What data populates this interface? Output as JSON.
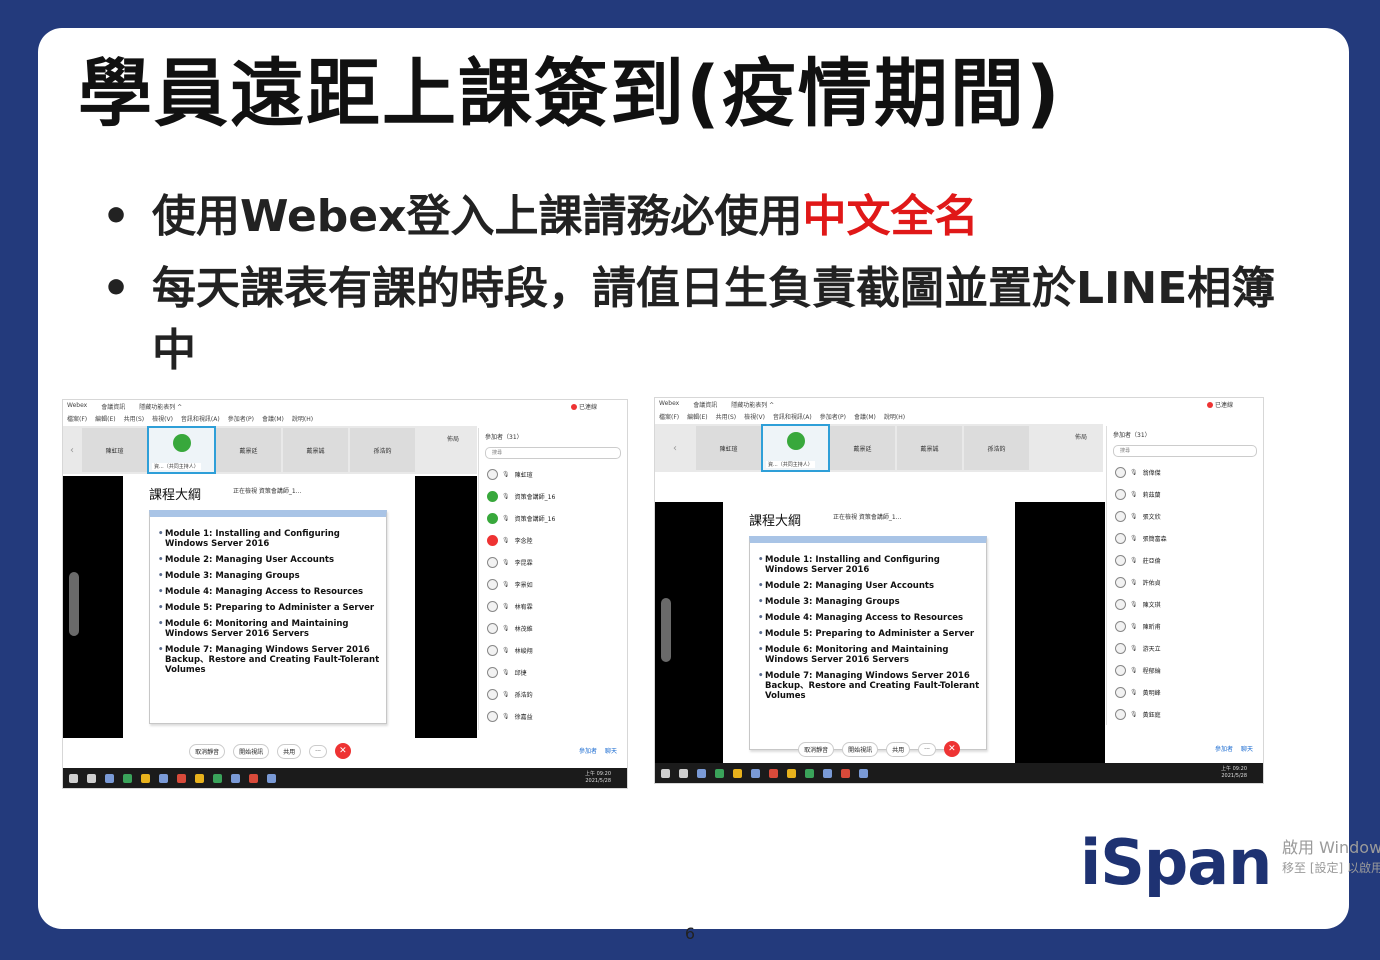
{
  "slide": {
    "title": "學員遠距上課簽到(疫情期間)",
    "bullets": [
      {
        "text": "使用Webex登入上課請務必使用",
        "highlight": "中文全名"
      },
      {
        "text": "每天課表有課的時段，請值日生負責截圖並置於LINE相簿中",
        "highlight": ""
      }
    ],
    "bullet_marker": "•",
    "page_number": "6",
    "brand": "iSpan",
    "watermark": {
      "line1": "啟用 Windows",
      "line2": "移至 [設定] 以啟用"
    }
  },
  "screenshot_left": {
    "titlebar": [
      "Webex",
      "會議資訊",
      "隱藏功能表列 ^"
    ],
    "record_badge": "已連線",
    "menu": [
      "檔案(F)",
      "編輯(E)",
      "共用(S)",
      "檢視(V)",
      "音訊和視訊(A)",
      "參加者(P)",
      "會議(M)",
      "說明(H)"
    ],
    "thumbs": [
      "陳虹瑄",
      "資策會講師",
      "戴景廷",
      "戴景誠",
      "孫浩鈞"
    ],
    "active_thumb_label": "資...（共同主持人）",
    "layout_label": "佈局",
    "participants_header": "參加者（31）",
    "search_placeholder": "搜尋",
    "participants": [
      "陳虹瑄",
      "資策會講師_16",
      "資策會講師_16",
      "李念陸",
      "李昆霖",
      "李景如",
      "林宥霖",
      "林茂維",
      "林峻翔",
      "邱捷",
      "孫浩鈞",
      "徐嘉益"
    ],
    "slide_title": "課程大綱",
    "slide_note": "正在檢視 資策會講師_1...",
    "modules": [
      "Module 1: Installing and Configuring Windows Server 2016",
      "Module 2: Managing User Accounts",
      "Module 3: Managing Groups",
      "Module 4: Managing Access to Resources",
      "Module 5: Preparing to Administer a Server",
      "Module 6: Monitoring and Maintaining  Windows Server 2016 Servers",
      "Module 7: Managing Windows Server 2016 Backup、Restore and Creating Fault-Tolerant Volumes"
    ],
    "controls": [
      "取消靜音",
      "開始視訊",
      "共用",
      "···"
    ],
    "end_icon": "✕",
    "right_controls": [
      "參加者",
      "聊天"
    ],
    "clock": {
      "time": "上午 09:20",
      "date": "2021/5/28"
    }
  },
  "screenshot_right": {
    "titlebar": [
      "Webex",
      "會議資訊",
      "隱藏功能表列 ^"
    ],
    "record_badge": "已連線",
    "menu": [
      "檔案(F)",
      "編輯(E)",
      "共用(S)",
      "檢視(V)",
      "音訊和視訊(A)",
      "參加者(P)",
      "會議(M)",
      "說明(H)"
    ],
    "thumbs": [
      "陳虹瑄",
      "資策會講師",
      "戴景廷",
      "戴景誠",
      "孫浩鈞"
    ],
    "active_thumb_label": "資...（共同主持人）",
    "layout_label": "佈局",
    "participants_header": "參加者（31）",
    "search_placeholder": "搜尋",
    "participants": [
      "翁偉傑",
      "莉茲蘭",
      "張文欣",
      "張簡富森",
      "莊亞倫",
      "許佑貞",
      "陳文琪",
      "陳昕甫",
      "游天立",
      "程郁綸",
      "黃明峰",
      "黃鈺庭"
    ],
    "slide_title": "課程大綱",
    "slide_note": "正在檢視 資策會講師_1...",
    "modules": [
      "Module 1: Installing and Configuring Windows Server 2016",
      "Module 2: Managing User Accounts",
      "Module 3: Managing Groups",
      "Module 4: Managing Access to Resources",
      "Module 5: Preparing to Administer a Server",
      "Module 6: Monitoring and Maintaining  Windows Server 2016 Servers",
      "Module 7: Managing Windows Server 2016 Backup、Restore and Creating Fault-Tolerant Volumes"
    ],
    "controls": [
      "取消靜音",
      "開始視訊",
      "共用",
      "···"
    ],
    "end_icon": "✕",
    "right_controls": [
      "參加者",
      "聊天"
    ],
    "clock": {
      "time": "上午 09:20",
      "date": "2021/5/28"
    }
  }
}
